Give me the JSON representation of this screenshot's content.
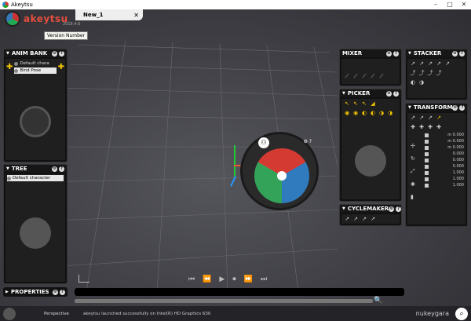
{
  "window": {
    "title": "Akeytsu",
    "minimize": "–",
    "maximize": "□",
    "close": "✕"
  },
  "tab": {
    "label": "New_1",
    "close": "✕"
  },
  "logo": {
    "brand": "akeytsu",
    "version": "2019.4.6"
  },
  "tooltip": "Version Number",
  "anim_bank": {
    "title": "ANIM BANK",
    "items": [
      {
        "label": "Default chara"
      },
      {
        "label": "Bind Pose"
      }
    ]
  },
  "tree": {
    "title": "TREE",
    "items": [
      {
        "label": "Default character"
      }
    ]
  },
  "properties": {
    "title": "PROPERTIES"
  },
  "mixer": {
    "title": "MIXER"
  },
  "stacker": {
    "title": "STACKER"
  },
  "picker": {
    "title": "PICKER"
  },
  "cyclemaker": {
    "title": "CYCLEMAKER"
  },
  "transform": {
    "title": "TRANSFORM",
    "rows": [
      {
        "value": "m 0.000"
      },
      {
        "value": "m 0.000"
      },
      {
        "value": "m 0.000"
      },
      {
        "value": "0.000"
      },
      {
        "value": "0.000"
      },
      {
        "value": "0.000"
      },
      {
        "value": "1.000"
      },
      {
        "value": "1.000"
      },
      {
        "value": "1.000"
      }
    ]
  },
  "status": {
    "view": "Perspective",
    "message": "akeytsu launched successfully on Intel(R) HD Graphics 630",
    "brand": "nukeygara"
  }
}
